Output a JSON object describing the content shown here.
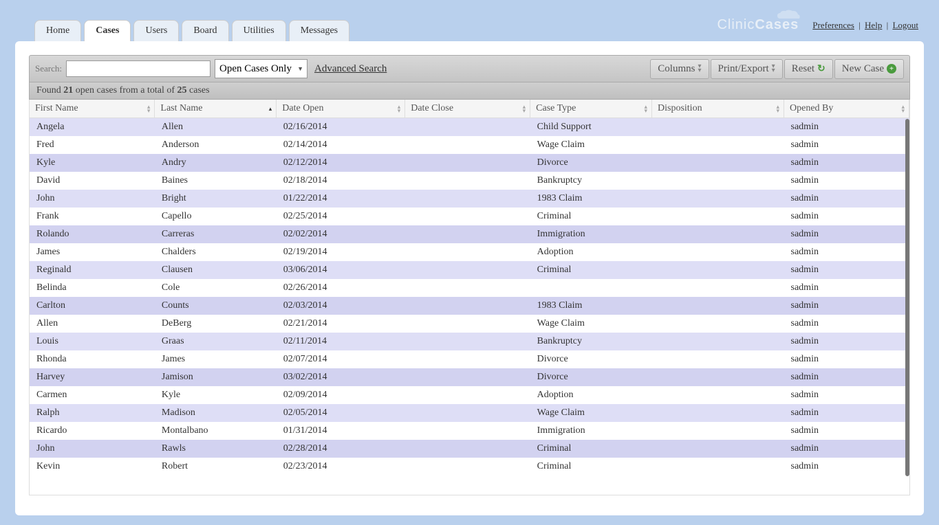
{
  "header": {
    "tabs": [
      "Home",
      "Cases",
      "Users",
      "Board",
      "Utilities",
      "Messages"
    ],
    "active_tab": 1,
    "logo_text_a": "Clinic",
    "logo_text_b": "Cases",
    "links": {
      "preferences": "Preferences",
      "help": "Help",
      "logout": "Logout"
    }
  },
  "toolbar": {
    "search_label": "Search:",
    "search_value": "",
    "filter_value": "Open Cases Only",
    "advanced_search": "Advanced Search",
    "columns": "Columns",
    "print_export": "Print/Export",
    "reset": "Reset",
    "new_case": "New Case"
  },
  "results": {
    "prefix": "Found ",
    "count": "21",
    "mid": " open cases from a total of ",
    "total": "25",
    "suffix": " cases"
  },
  "columns": [
    "First Name",
    "Last Name",
    "Date Open",
    "Date Close",
    "Case Type",
    "Disposition",
    "Opened By"
  ],
  "sort_column": 1,
  "rows": [
    {
      "fn": "Angela",
      "ln": "Allen",
      "do": "02/16/2014",
      "dc": "",
      "ct": "Child Support",
      "di": "",
      "ob": "sadmin"
    },
    {
      "fn": "Fred",
      "ln": "Anderson",
      "do": "02/14/2014",
      "dc": "",
      "ct": "Wage Claim",
      "di": "",
      "ob": "sadmin"
    },
    {
      "fn": "Kyle",
      "ln": "Andry",
      "do": "02/12/2014",
      "dc": "",
      "ct": "Divorce",
      "di": "",
      "ob": "sadmin"
    },
    {
      "fn": "David",
      "ln": "Baines",
      "do": "02/18/2014",
      "dc": "",
      "ct": "Bankruptcy",
      "di": "",
      "ob": "sadmin"
    },
    {
      "fn": "John",
      "ln": "Bright",
      "do": "01/22/2014",
      "dc": "",
      "ct": "1983 Claim",
      "di": "",
      "ob": "sadmin"
    },
    {
      "fn": "Frank",
      "ln": "Capello",
      "do": "02/25/2014",
      "dc": "",
      "ct": "Criminal",
      "di": "",
      "ob": "sadmin"
    },
    {
      "fn": "Rolando",
      "ln": "Carreras",
      "do": "02/02/2014",
      "dc": "",
      "ct": "Immigration",
      "di": "",
      "ob": "sadmin"
    },
    {
      "fn": "James",
      "ln": "Chalders",
      "do": "02/19/2014",
      "dc": "",
      "ct": "Adoption",
      "di": "",
      "ob": "sadmin"
    },
    {
      "fn": "Reginald",
      "ln": "Clausen",
      "do": "03/06/2014",
      "dc": "",
      "ct": "Criminal",
      "di": "",
      "ob": "sadmin"
    },
    {
      "fn": "Belinda",
      "ln": "Cole",
      "do": "02/26/2014",
      "dc": "",
      "ct": "",
      "di": "",
      "ob": "sadmin"
    },
    {
      "fn": "Carlton",
      "ln": "Counts",
      "do": "02/03/2014",
      "dc": "",
      "ct": "1983 Claim",
      "di": "",
      "ob": "sadmin"
    },
    {
      "fn": "Allen",
      "ln": "DeBerg",
      "do": "02/21/2014",
      "dc": "",
      "ct": "Wage Claim",
      "di": "",
      "ob": "sadmin"
    },
    {
      "fn": "Louis",
      "ln": "Graas",
      "do": "02/11/2014",
      "dc": "",
      "ct": "Bankruptcy",
      "di": "",
      "ob": "sadmin"
    },
    {
      "fn": "Rhonda",
      "ln": "James",
      "do": "02/07/2014",
      "dc": "",
      "ct": "Divorce",
      "di": "",
      "ob": "sadmin"
    },
    {
      "fn": "Harvey",
      "ln": "Jamison",
      "do": "03/02/2014",
      "dc": "",
      "ct": "Divorce",
      "di": "",
      "ob": "sadmin"
    },
    {
      "fn": "Carmen",
      "ln": "Kyle",
      "do": "02/09/2014",
      "dc": "",
      "ct": "Adoption",
      "di": "",
      "ob": "sadmin"
    },
    {
      "fn": "Ralph",
      "ln": "Madison",
      "do": "02/05/2014",
      "dc": "",
      "ct": "Wage Claim",
      "di": "",
      "ob": "sadmin"
    },
    {
      "fn": "Ricardo",
      "ln": "Montalbano",
      "do": "01/31/2014",
      "dc": "",
      "ct": "Immigration",
      "di": "",
      "ob": "sadmin"
    },
    {
      "fn": "John",
      "ln": "Rawls",
      "do": "02/28/2014",
      "dc": "",
      "ct": "Criminal",
      "di": "",
      "ob": "sadmin"
    },
    {
      "fn": "Kevin",
      "ln": "Robert",
      "do": "02/23/2014",
      "dc": "",
      "ct": "Criminal",
      "di": "",
      "ob": "sadmin"
    }
  ]
}
